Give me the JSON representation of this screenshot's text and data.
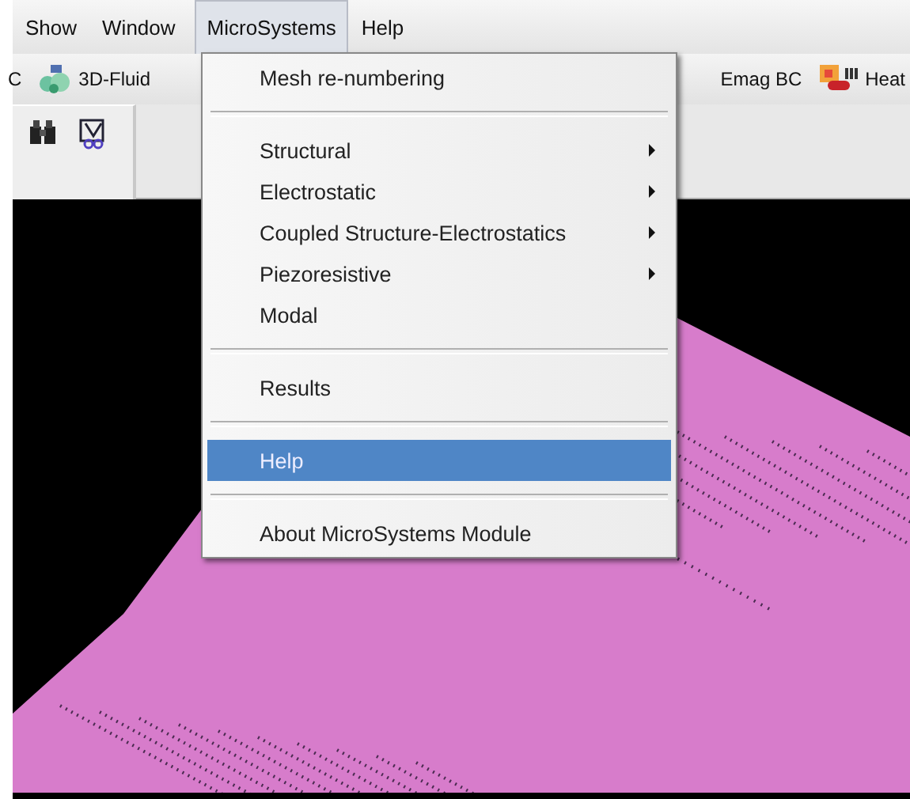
{
  "menubar": [
    {
      "label": "Show",
      "selected": false
    },
    {
      "label": "Window",
      "selected": false
    },
    {
      "label": "MicroSystems",
      "selected": true
    },
    {
      "label": "Help",
      "selected": false
    }
  ],
  "toolbar": {
    "left": [
      {
        "label": "C"
      },
      {
        "label": "3D-Fluid"
      }
    ],
    "right": [
      {
        "label": "Emag BC"
      },
      {
        "label": "Heat"
      }
    ]
  },
  "menu": [
    {
      "kind": "item",
      "label": "Mesh re-numbering",
      "submenu": false,
      "selected": false
    },
    {
      "kind": "separator"
    },
    {
      "kind": "item",
      "label": "Structural",
      "submenu": true,
      "selected": false
    },
    {
      "kind": "item",
      "label": "Electrostatic",
      "submenu": true,
      "selected": false
    },
    {
      "kind": "item",
      "label": "Coupled Structure-Electrostatics",
      "submenu": true,
      "selected": false
    },
    {
      "kind": "item",
      "label": "Piezoresistive",
      "submenu": true,
      "selected": false
    },
    {
      "kind": "item",
      "label": "Modal",
      "submenu": false,
      "selected": false
    },
    {
      "kind": "separator"
    },
    {
      "kind": "item",
      "label": "Results",
      "submenu": false,
      "selected": false
    },
    {
      "kind": "separator"
    },
    {
      "kind": "item",
      "label": "Help",
      "submenu": false,
      "selected": true
    },
    {
      "kind": "separator"
    },
    {
      "kind": "item",
      "label": "About MicroSystems Module",
      "submenu": false,
      "selected": false
    }
  ],
  "viewport": {
    "kind": "mesh"
  }
}
